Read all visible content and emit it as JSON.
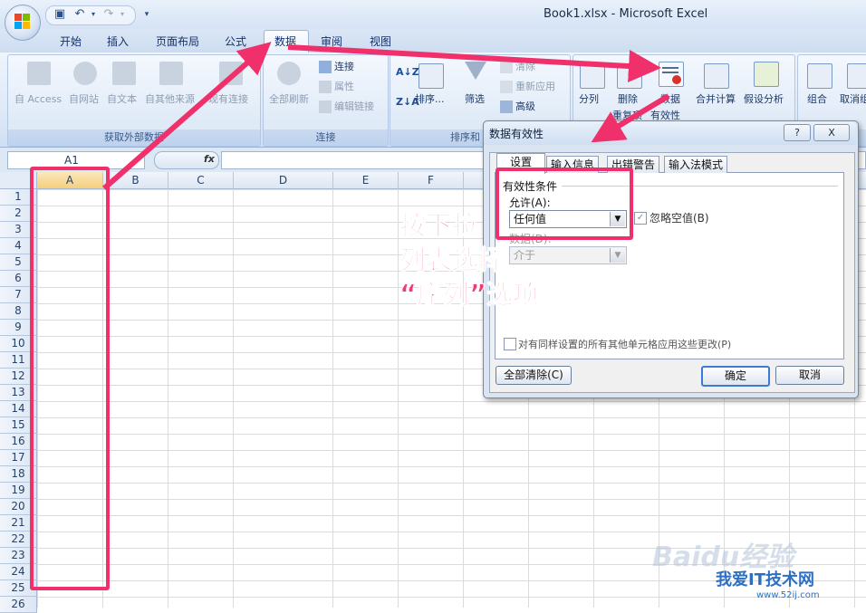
{
  "window": {
    "title": "Book1.xlsx - Microsoft Excel"
  },
  "tabs": [
    "开始",
    "插入",
    "页面布局",
    "公式",
    "数据",
    "审阅",
    "视图"
  ],
  "active_tab": "数据",
  "ribbon": {
    "get_external": {
      "label": "获取外部数据",
      "buttons": [
        "自 Access",
        "自网站",
        "自文本",
        "自其他来源",
        "现有连接"
      ]
    },
    "connections": {
      "label": "连接",
      "refresh_all": "全部刷新",
      "items": [
        "连接",
        "属性",
        "编辑链接"
      ]
    },
    "sort_filter": {
      "label": "排序和",
      "sort": "排序...",
      "filter": "筛选",
      "items": [
        "清除",
        "重新应用",
        "高级"
      ]
    },
    "data_tools": {
      "split": "分列",
      "remove": "删除",
      "remove2": "重复项",
      "validation": "数据",
      "validation2": "有效性",
      "consolidate": "合并计算",
      "whatif": "假设分析"
    },
    "outline": {
      "group": "组合",
      "ungroup": "取消组"
    }
  },
  "formula_bar": {
    "name_box": "A1",
    "fx": "fx"
  },
  "columns": [
    "A",
    "B",
    "C",
    "D",
    "E",
    "F"
  ],
  "rows": [
    "1",
    "2",
    "3",
    "4",
    "5",
    "6",
    "7",
    "8",
    "9",
    "10",
    "11",
    "12",
    "13",
    "14",
    "15",
    "16",
    "17",
    "18",
    "19",
    "20",
    "21",
    "22",
    "23",
    "24",
    "25",
    "26"
  ],
  "dialog": {
    "title": "数据有效性",
    "help": "?",
    "close": "X",
    "tabs": [
      "设置",
      "输入信息",
      "出错警告",
      "输入法模式"
    ],
    "section": "有效性条件",
    "allow_label": "允许(A):",
    "allow_value": "任何值",
    "ignore_blank": "忽略空值(B)",
    "data_label": "数据(D):",
    "data_value": "介于",
    "apply_all": "对有同样设置的所有其他单元格应用这些更改(P)",
    "clear_all": "全部清除(C)",
    "ok": "确定",
    "cancel": "取消"
  },
  "annotation": {
    "line1": "按下拉",
    "line2": "列表选择",
    "line3": "“序列”选项",
    "color": "#f0306a"
  },
  "watermark": {
    "brand": "Baidu经验",
    "site": "我爱IT技术网",
    "url": "www.52ij.com"
  }
}
